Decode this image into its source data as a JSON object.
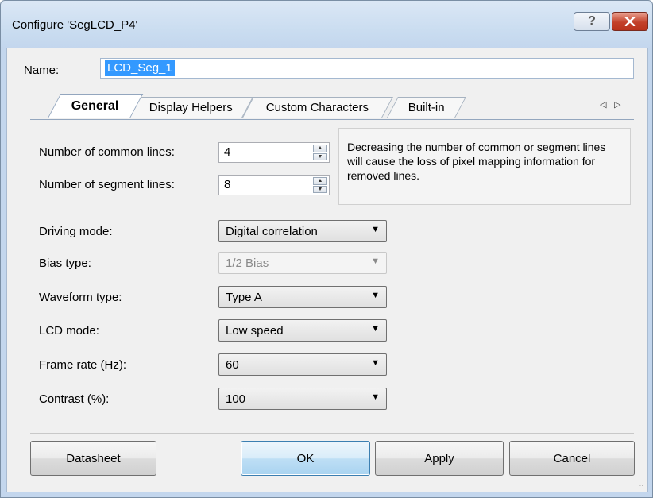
{
  "window": {
    "title": "Configure 'SegLCD_P4'",
    "help_glyph": "?",
    "close_glyph": "✕"
  },
  "name": {
    "label": "Name:",
    "value": "LCD_Seg_1"
  },
  "tabs": [
    {
      "label": "General",
      "active": true
    },
    {
      "label": "Display Helpers",
      "active": false
    },
    {
      "label": "Custom Characters",
      "active": false
    },
    {
      "label": "Built-in",
      "active": false
    }
  ],
  "tab_scroll": {
    "left": "◁",
    "right": "▷"
  },
  "general": {
    "common_lines": {
      "label": "Number of common lines:",
      "value": "4"
    },
    "segment_lines": {
      "label": "Number of segment lines:",
      "value": "8"
    },
    "info_text": "Decreasing the number of common or segment lines will cause the loss of pixel mapping information for removed lines.",
    "driving_mode": {
      "label": "Driving mode:",
      "value": "Digital correlation"
    },
    "bias_type": {
      "label": "Bias type:",
      "value": "1/2 Bias",
      "disabled": true
    },
    "waveform_type": {
      "label": "Waveform type:",
      "value": "Type A"
    },
    "lcd_mode": {
      "label": "LCD mode:",
      "value": "Low speed"
    },
    "frame_rate": {
      "label": "Frame rate (Hz):",
      "value": "60"
    },
    "contrast": {
      "label": "Contrast (%):",
      "value": "100"
    }
  },
  "buttons": {
    "datasheet": "Datasheet",
    "ok": "OK",
    "apply": "Apply",
    "cancel": "Cancel"
  }
}
